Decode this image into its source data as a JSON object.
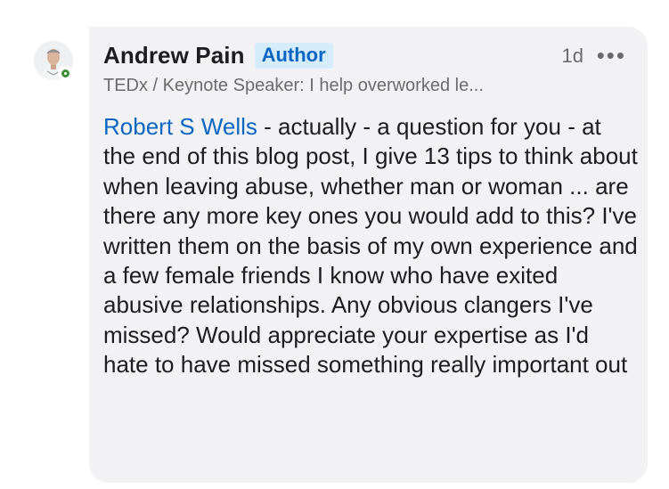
{
  "comment": {
    "author": {
      "name": "Andrew Pain",
      "badge": "Author",
      "headline": "TEDx / Keynote Speaker: I help overworked le...",
      "online": true
    },
    "time": "1d",
    "more_icon": "more-horizontal-icon",
    "mention": "Robert S Wells",
    "text": " - actually - a question for you - at the end of this blog post, I give 13 tips to think about when leaving abuse, whether man or woman ... are there any more key ones you would add to this? I've written them on the basis of my own experience and a few female friends I know who have exited abusive relationships. Any obvious clangers I've missed? Would appreciate your expertise as I'd hate to have missed something really important out"
  },
  "colors": {
    "bubble_bg": "#f2f2f4",
    "link": "#0a66c2",
    "badge_bg": "#d5ecfa",
    "presence": "#3f8f3a",
    "secondary_text": "#6b6b6b"
  }
}
